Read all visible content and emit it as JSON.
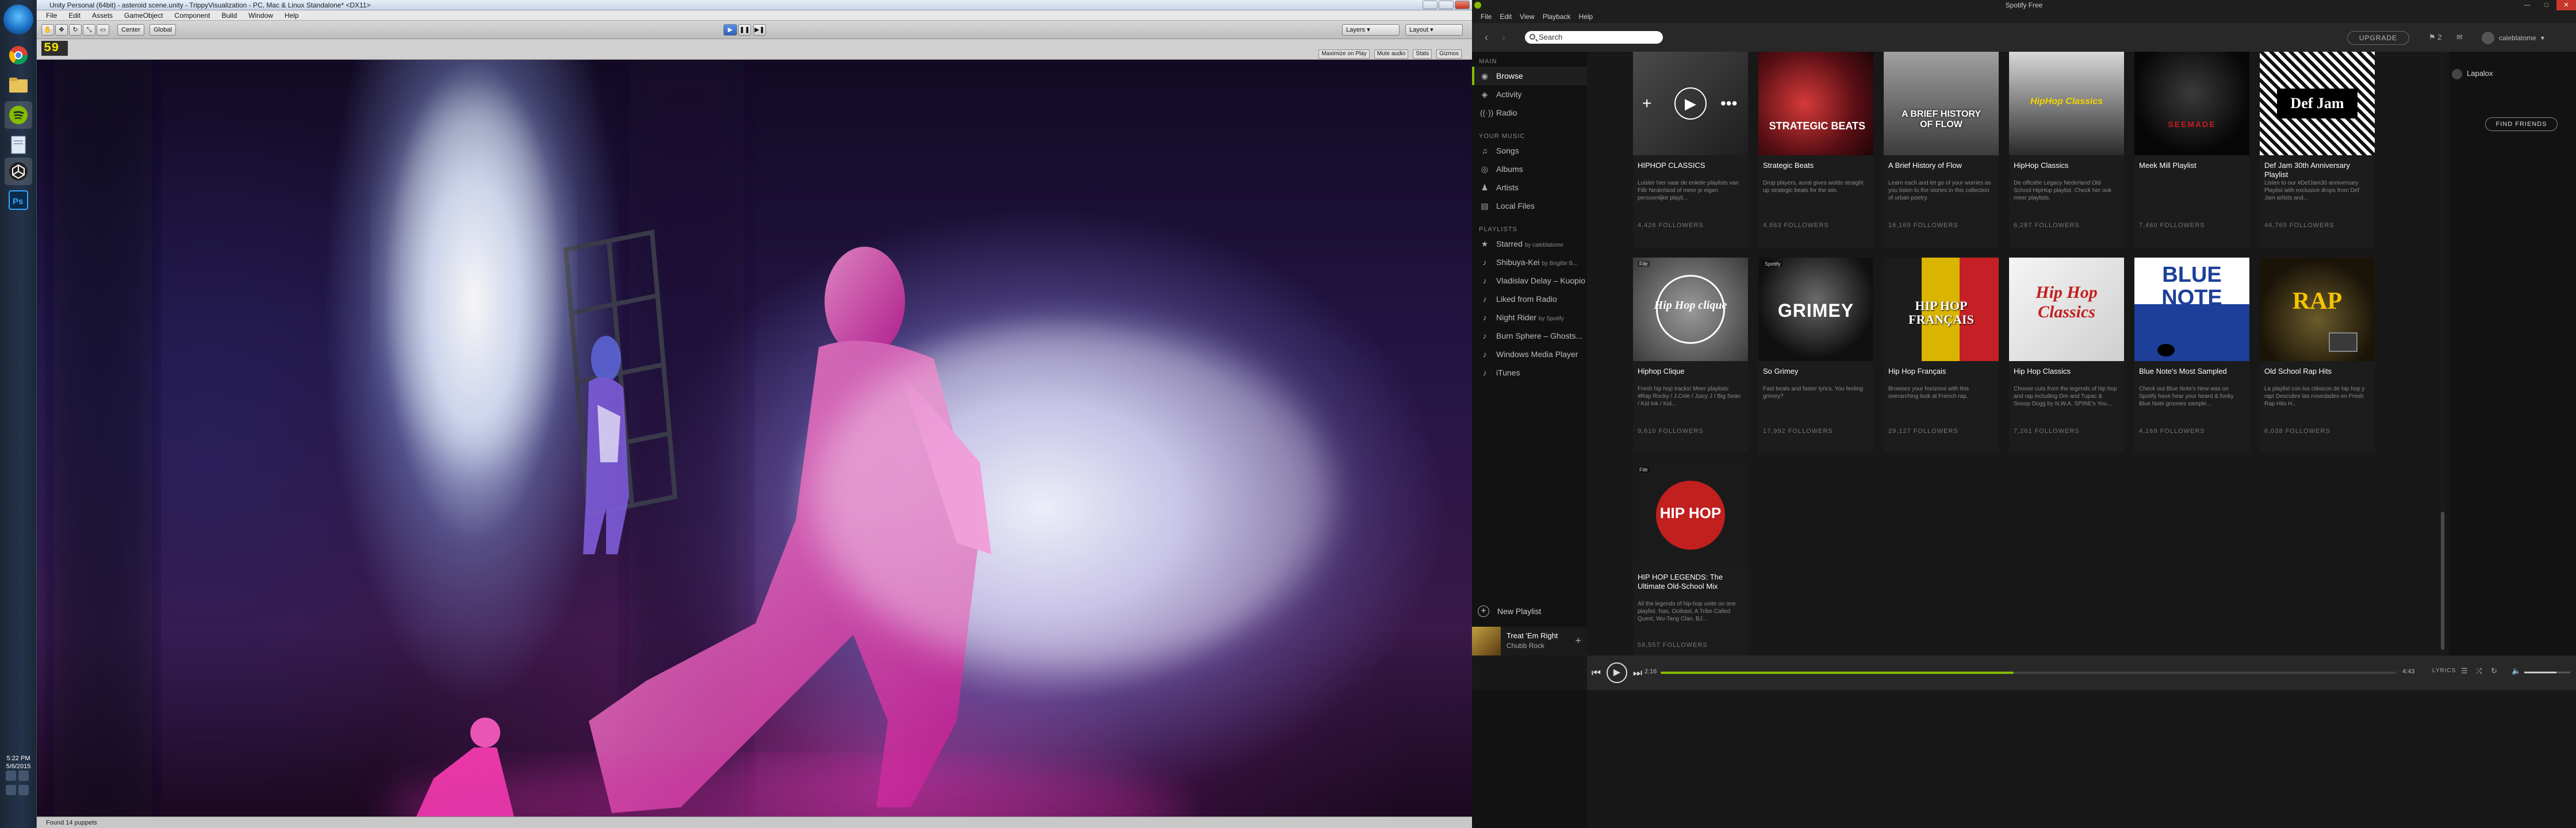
{
  "taskbar": {
    "clock_time": "5:22 PM",
    "clock_date": "5/6/2015",
    "apps": [
      "windows-start",
      "chrome",
      "explorer",
      "spotify",
      "unity",
      "wmp",
      "photoshop"
    ]
  },
  "unity": {
    "title": "Unity Personal (64bit) - asteroid scene.unity - TrippyVisualization - PC, Mac & Linux Standalone* <DX11>",
    "menu": [
      "File",
      "Edit",
      "Assets",
      "GameObject",
      "Component",
      "Build",
      "Window",
      "Help"
    ],
    "toolbar": {
      "center": "Center",
      "global": "Global",
      "layers": "Layers",
      "layout": "Layout"
    },
    "game": {
      "fps_label": "59",
      "options": [
        "Maximize on Play",
        "Mute audio",
        "Stats",
        "Gizmos"
      ]
    },
    "status": "Found 14 puppets"
  },
  "spotify": {
    "window_title": "Spotify Free",
    "menu": [
      "File",
      "Edit",
      "View",
      "Playback",
      "Help"
    ],
    "search_placeholder": "Search",
    "upgrade_label": "UPGRADE",
    "notifications_count": "2",
    "username": "caleblatome",
    "sidebar": {
      "main_header": "MAIN",
      "main": [
        {
          "label": "Browse",
          "icon": "browse-icon",
          "active": true
        },
        {
          "label": "Activity",
          "icon": "activity-icon"
        },
        {
          "label": "Radio",
          "icon": "radio-icon"
        }
      ],
      "music_header": "YOUR MUSIC",
      "music": [
        {
          "label": "Songs",
          "icon": "songs-icon"
        },
        {
          "label": "Albums",
          "icon": "albums-icon"
        },
        {
          "label": "Artists",
          "icon": "artists-icon"
        },
        {
          "label": "Local Files",
          "icon": "local-files-icon"
        }
      ],
      "playlists_header": "PLAYLISTS",
      "playlists": [
        {
          "label": "Starred",
          "by": "by caleblatome",
          "icon": "star-icon"
        },
        {
          "label": "Shibuya-Kei",
          "by": "by Brigitte B...",
          "icon": "note-icon"
        },
        {
          "label": "Vladislav Delay – Kuopio",
          "by": "",
          "icon": "note-icon"
        },
        {
          "label": "Liked from Radio",
          "by": "",
          "icon": "note-icon"
        },
        {
          "label": "Night Rider",
          "by": "by Spotify",
          "icon": "note-icon"
        },
        {
          "label": "Burn Sphere – Ghosts...",
          "by": "",
          "icon": "note-icon"
        },
        {
          "label": "Windows Media Player",
          "by": "",
          "icon": "note-icon"
        },
        {
          "label": "iTunes",
          "by": "",
          "icon": "note-icon"
        }
      ],
      "new_playlist": "New Playlist",
      "now_playing": {
        "title": "Treat 'Em Right",
        "artist": "Chubb Rock"
      }
    },
    "cards": [
      {
        "title": "HIPHOP CLASSICS",
        "desc": "Luister hier naar de enkele playlists van Filtr Nederland of meer je eigen persoonlijke playli...",
        "followers": "4,426 FOLLOWERS",
        "cover": "hover"
      },
      {
        "title": "Strategic Beats",
        "desc": "Drop players, aural gives wolds straight up strategic beats for the win.",
        "followers": "4,863 FOLLOWERS",
        "cover": "strategic",
        "cover_text": "STRATEGIC BEATS"
      },
      {
        "title": "A Brief History of Flow",
        "desc": "Learn each and let go of your worries as you listen to the stories in this collection of urban poetry.",
        "followers": "16,169 FOLLOWERS",
        "cover": "history",
        "cover_text": "A BRIEF HISTORY OF FLOW"
      },
      {
        "title": "HipHop Classics",
        "desc": "De officiële Legacy Nederland Old School HipHop playlist. Check her ook meer playlists.",
        "followers": "6,287 FOLLOWERS",
        "cover": "hhc",
        "cover_text": "HipHop Classics"
      },
      {
        "title": "Meek Mill Playlist",
        "desc": "",
        "followers": "7,460 FOLLOWERS",
        "cover": "meek",
        "cover_text": "SEEMADE"
      },
      {
        "title": "Def Jam 30th Anniversary Playlist",
        "desc": "Listen to our #DefJam30 anniversary Playlist with exclusive drops from Def Jam artists and...",
        "followers": "46,769 FOLLOWERS",
        "cover": "defjam",
        "cover_text": "Def Jam"
      },
      {
        "title": "Hiphop Clique",
        "desc": "Fresh hip hop tracks! Meer playlists: #Rap Rocky / J.Cole / Juicy J / Big Sean / Kid Ink / Kid...",
        "followers": "9,610 FOLLOWERS",
        "cover": "clique",
        "cover_text": "Hip Hop clique"
      },
      {
        "title": "So Grimey",
        "desc": "Fast beats and faster lyrics. You feeling grimey?",
        "followers": "17,992 FOLLOWERS",
        "cover": "grimey",
        "cover_text": "GRIMEY"
      },
      {
        "title": "Hip Hop Français",
        "desc": "Browsez your horizons with this overarching look at French rap.",
        "followers": "29,127 FOLLOWERS",
        "cover": "francais",
        "cover_text": "HIP HOP FRANÇAIS"
      },
      {
        "title": "Hip Hop Classics",
        "desc": "Choose cuts from the legends of hip hop and rap including Dre and Tupac & Snoop Dogg by N.W.A. SPINE's You...",
        "followers": "7,261 FOLLOWERS",
        "cover": "classics",
        "cover_text": "Hip Hop Classics"
      },
      {
        "title": "Blue Note's Most Sampled",
        "desc": "Check out Blue Note's New was on Spotify have hear your heard & funky Blue Note grooves sample...",
        "followers": "4,169 FOLLOWERS",
        "cover": "bluenote",
        "cover_text": "BLUE NOTE"
      },
      {
        "title": "Old School Rap Hits",
        "desc": "La playlist con los clásicos de hip hop y rap! Descubre las novedades en Fresh Rap Hits H...",
        "followers": "6,038 FOLLOWERS",
        "cover": "oldschool",
        "cover_text": "RAP"
      },
      {
        "title": "HIP HOP LEGENDS: The Ultimate Old-School Mix",
        "desc": "All the legends of hip-hop unite on one playlist. Nas, Outkast, A Tribe Called Quest, Wu-Tang Clan, BJ...",
        "followers": "58,557 FOLLOWERS",
        "cover": "legends",
        "cover_text": "HIP HOP"
      }
    ],
    "friends": {
      "name": "Lapalox",
      "find_button": "FIND FRIENDS"
    },
    "player": {
      "elapsed": "2:16",
      "duration": "4:43",
      "progress": 0.48,
      "lyrics_label": "LYRICS",
      "volume": 0.7
    }
  }
}
